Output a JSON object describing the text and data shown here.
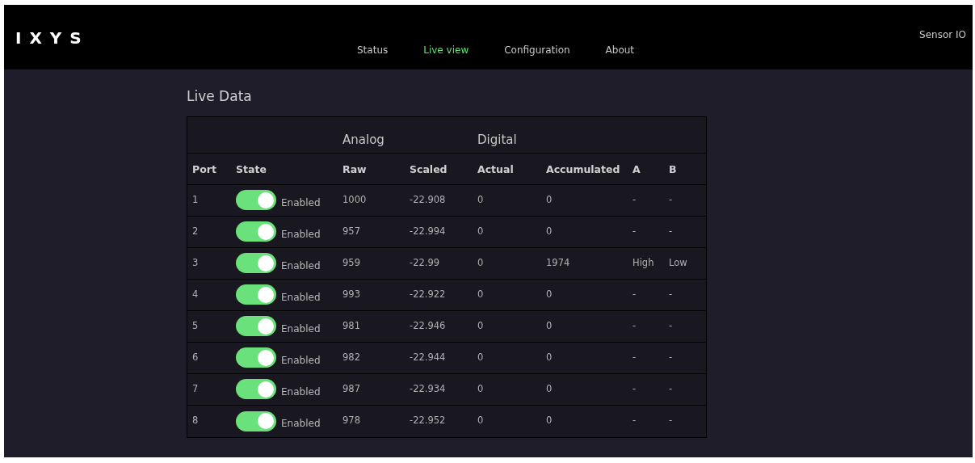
{
  "header": {
    "logo": "IXYS",
    "nav": [
      {
        "label": "Status",
        "selected": false
      },
      {
        "label": "Live view",
        "selected": true
      },
      {
        "label": "Configuration",
        "selected": false
      },
      {
        "label": "About",
        "selected": false
      }
    ],
    "product": "Sensor IO"
  },
  "title": "Live Data",
  "table": {
    "groups": [
      {
        "label": "Analog"
      },
      {
        "label": "Digital"
      }
    ],
    "columns": [
      "Port",
      "State",
      "Raw",
      "Scaled",
      "Actual",
      "Accumulated",
      "A",
      "B"
    ],
    "rows": [
      {
        "port": "1",
        "on": true,
        "state": "Enabled",
        "raw": "1000",
        "scaled": "-22.908",
        "actual": "0",
        "accumulated": "0",
        "a": "-",
        "b": "-"
      },
      {
        "port": "2",
        "on": true,
        "state": "Enabled",
        "raw": "957",
        "scaled": "-22.994",
        "actual": "0",
        "accumulated": "0",
        "a": "-",
        "b": "-"
      },
      {
        "port": "3",
        "on": true,
        "state": "Enabled",
        "raw": "959",
        "scaled": "-22.99",
        "actual": "0",
        "accumulated": "1974",
        "a": "High",
        "b": "Low"
      },
      {
        "port": "4",
        "on": true,
        "state": "Enabled",
        "raw": "993",
        "scaled": "-22.922",
        "actual": "0",
        "accumulated": "0",
        "a": "-",
        "b": "-"
      },
      {
        "port": "5",
        "on": true,
        "state": "Enabled",
        "raw": "981",
        "scaled": "-22.946",
        "actual": "0",
        "accumulated": "0",
        "a": "-",
        "b": "-"
      },
      {
        "port": "6",
        "on": true,
        "state": "Enabled",
        "raw": "982",
        "scaled": "-22.944",
        "actual": "0",
        "accumulated": "0",
        "a": "-",
        "b": "-"
      },
      {
        "port": "7",
        "on": true,
        "state": "Enabled",
        "raw": "987",
        "scaled": "-22.934",
        "actual": "0",
        "accumulated": "0",
        "a": "-",
        "b": "-"
      },
      {
        "port": "8",
        "on": true,
        "state": "Enabled",
        "raw": "978",
        "scaled": "-22.952",
        "actual": "0",
        "accumulated": "0",
        "a": "-",
        "b": "-"
      }
    ]
  }
}
